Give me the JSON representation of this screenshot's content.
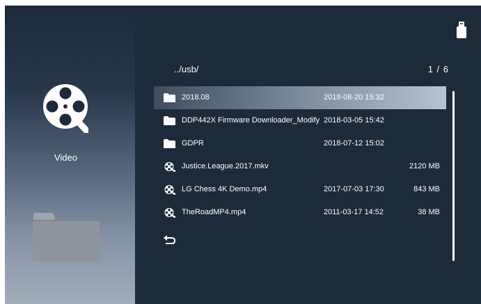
{
  "sidebar": {
    "label": "Video"
  },
  "browser": {
    "path": "../usb/",
    "page": "1 / 6"
  },
  "files": [
    {
      "type": "folder",
      "name": "2018.08",
      "date": "2018-08-20 15:32",
      "size": "",
      "selected": true
    },
    {
      "type": "folder",
      "name": "DDP442X Firmware Downloader_Modify",
      "date": "2018-03-05 15:42",
      "size": "",
      "selected": false
    },
    {
      "type": "folder",
      "name": "GDPR",
      "date": "2018-07-12 15:02",
      "size": "",
      "selected": false
    },
    {
      "type": "video",
      "name": "Justice.League.2017.mkv",
      "date": "",
      "size": "2120 MB",
      "selected": false
    },
    {
      "type": "video",
      "name": "LG Chess 4K Demo.mp4",
      "date": "2017-07-03 17:30",
      "size": "843 MB",
      "selected": false
    },
    {
      "type": "video",
      "name": "TheRoadMP4.mp4",
      "date": "2011-03-17 14:52",
      "size": "38 MB",
      "selected": false
    }
  ],
  "icons": {
    "sidebar_top": "video-reel-icon",
    "sidebar_bottom": "folder-icon",
    "status": "usb-drive-icon",
    "back": "back-arrow-icon",
    "folder_row": "folder-icon",
    "video_row": "film-reel-icon"
  },
  "colors": {
    "background": "#1d2a3a",
    "text": "#ffffff",
    "selection": "#b9c3cf"
  }
}
